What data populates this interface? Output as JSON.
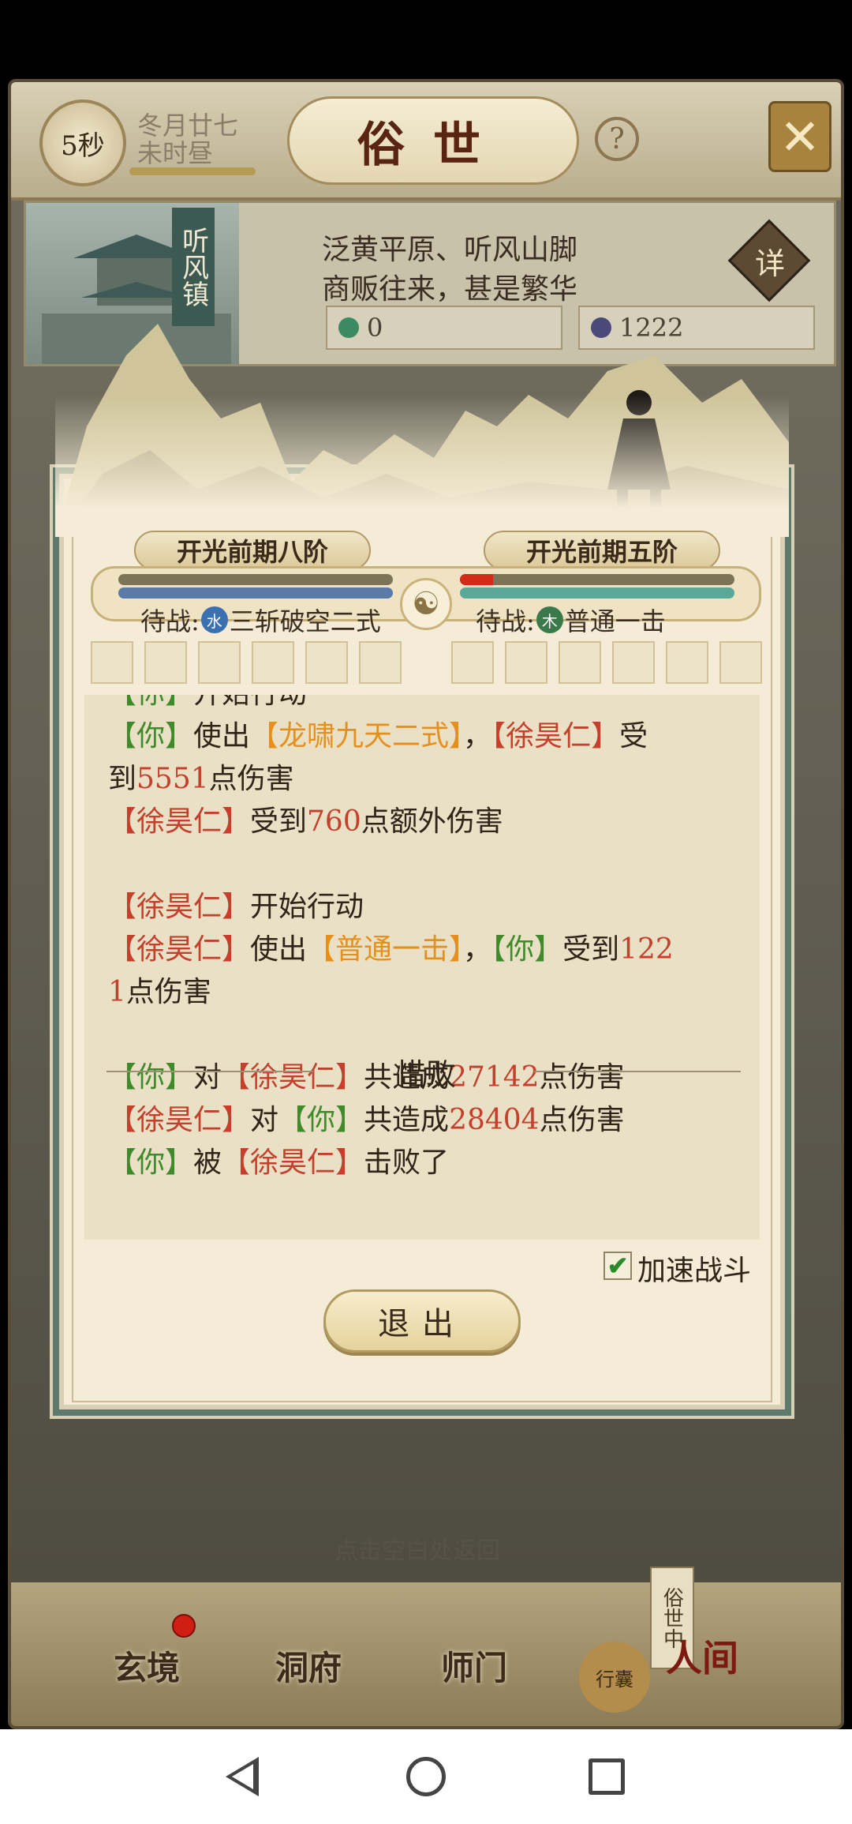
{
  "header": {
    "timer": "5秒",
    "date_line1": "冬月廿七",
    "date_line2": "未时昼",
    "title": "俗世",
    "help": "?"
  },
  "location": {
    "name": "听风镇",
    "line1": "泛黄平原、听风山脚",
    "line2": "商贩往来，甚是繁华",
    "resource1": "0",
    "resource2": "1222",
    "detail": "详"
  },
  "battle": {
    "player_rank": "开光前期八阶",
    "enemy_rank": "开光前期五阶",
    "player_standby_label": "待战:",
    "player_element": "水",
    "player_skill": "三斩破空二式",
    "enemy_standby_label": "待战:",
    "enemy_element": "木",
    "enemy_skill": "普通一击",
    "player_hp_fraction": 0.0,
    "enemy_hp_fraction": 0.12,
    "log": {
      "line0": {
        "a": "【你】",
        "b": "开始行动"
      },
      "line1": {
        "a": "【你】",
        "b": "使出",
        "c": "【龙啸九天二式】",
        "d": "，",
        "e": "【徐昊仁】",
        "f": "受"
      },
      "line2": {
        "a": "到",
        "b": "5551",
        "c": "点伤害"
      },
      "line3": {
        "a": "【徐昊仁】",
        "b": "受到",
        "c": "760",
        "d": "点额外伤害"
      },
      "line4": {
        "a": "【徐昊仁】",
        "b": "开始行动"
      },
      "line5": {
        "a": "【徐昊仁】",
        "b": "使出",
        "c": "【普通一击】",
        "d": "，",
        "e": "【你】",
        "f": "受到",
        "g": "122"
      },
      "line6": {
        "a": "1",
        "b": "点伤害"
      },
      "result_title": "惜败",
      "line7": {
        "a": "【你】",
        "b": "对",
        "c": "【徐昊仁】",
        "d": "共造成",
        "e": "27142",
        "f": "点伤害"
      },
      "line8": {
        "a": "【徐昊仁】",
        "b": "对",
        "c": "【你】",
        "d": "共造成",
        "e": "28404",
        "f": "点伤害"
      },
      "line9": {
        "a": "【你】",
        "b": "被",
        "c": "【徐昊仁】",
        "d": "击败了"
      }
    },
    "speed_label": "加速战斗",
    "speed_checked": true,
    "exit_label": "退出"
  },
  "background": {
    "return_hint": "点击空白处返回"
  },
  "nav": {
    "xuanjing": "玄境",
    "dongfu": "洞府",
    "shimen": "师门",
    "bag": "行囊",
    "sushi_badge": "俗世中",
    "renjian": "人间"
  },
  "colors": {
    "player_name": "#3f8a2a",
    "enemy_name": "#c4402c",
    "skill": "#e5901c",
    "damage": "#c4402c"
  }
}
